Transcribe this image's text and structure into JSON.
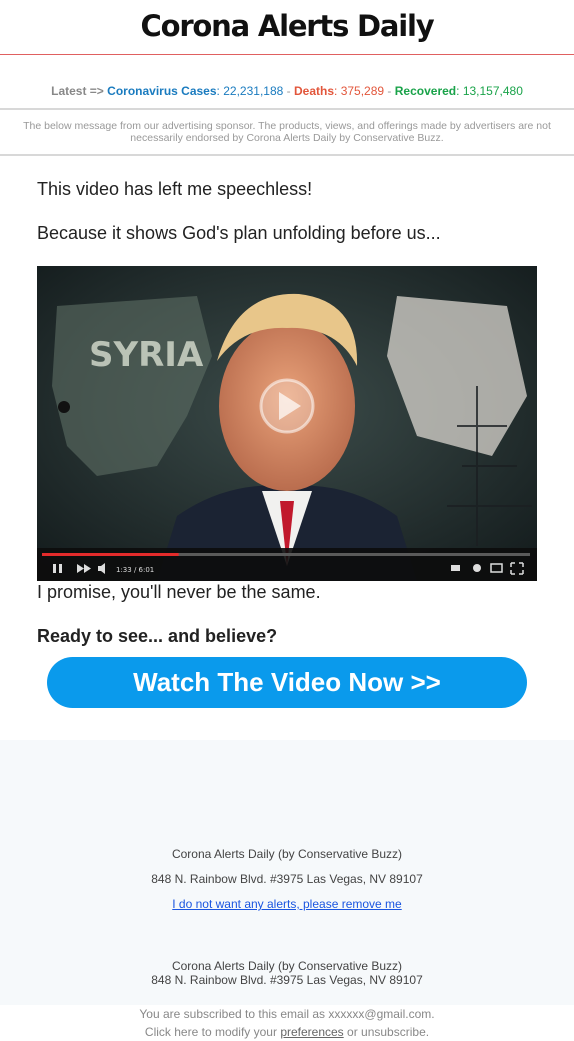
{
  "header": {
    "logo": "Corona Alerts Daily"
  },
  "stats": {
    "latest": "Latest =>",
    "cases_label": "Coronavirus Cases",
    "cases_value": "22,231,188",
    "sep1": "-",
    "deaths_label": "Deaths",
    "deaths_value": "375,289",
    "sep2": "-",
    "recovered_label": "Recovered",
    "recovered_value": "13,157,480",
    "colon": ":"
  },
  "disclaimer": "The below message from our advertising sponsor. The products, views, and offerings made by advertisers are not necessarily endorsed by Corona Alerts Daily by Conservative Buzz.",
  "content": {
    "line1": "This video has left me speechless!",
    "line2": "Because it shows God's plan unfolding before us...",
    "line3": "I promise, you'll never be the same.",
    "line4": "Ready to see... and believe?",
    "cta": "Watch The Video Now >>"
  },
  "video": {
    "map_label": "SYRIA",
    "time": "1:33 / 6:01",
    "progress": 0.28
  },
  "footer": {
    "company": "Corona Alerts Daily (by Conservative Buzz)",
    "address": "848 N. Rainbow Blvd. #3975 Las Vegas, NV 89107",
    "unsubscribe": "I do not want any alerts, please remove me",
    "company2": "Corona Alerts Daily (by Conservative Buzz)",
    "address2": "848 N. Rainbow Blvd. #3975 Las Vegas, NV 89107"
  },
  "subscription": {
    "line1": "You are subscribed to this email as xxxxxx@gmail.com.",
    "click_here": "Click here to modify your",
    "preferences": "preferences",
    "or_unsub": "or unsubscribe."
  },
  "colors": {
    "cta": "#0a9aec",
    "cases": "#1a7bbf",
    "deaths": "#e2563b",
    "recovered": "#1aa34a",
    "header_rule": "#e06060"
  }
}
